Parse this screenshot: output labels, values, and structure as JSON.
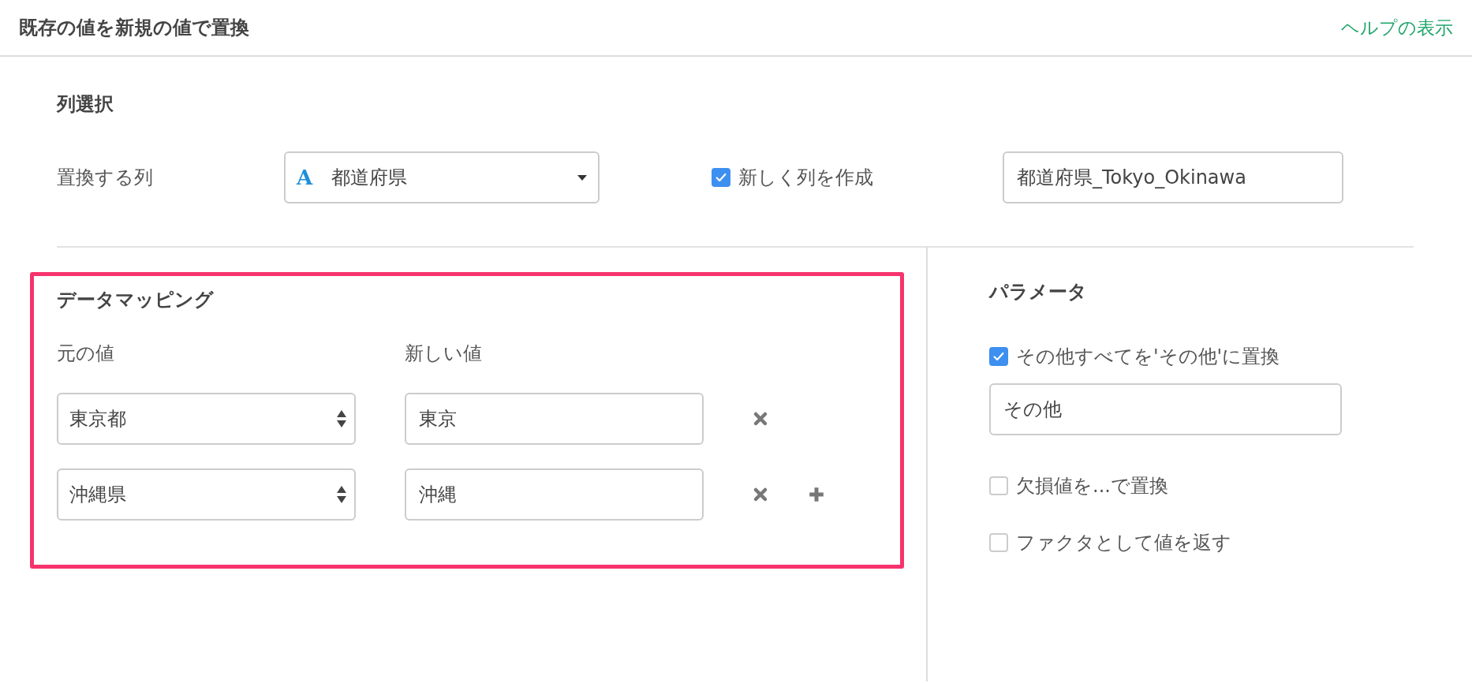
{
  "header": {
    "title": "既存の値を新規の値で置換",
    "help_link": "ヘルプの表示"
  },
  "column_selection": {
    "heading": "列選択",
    "label": "置換する列",
    "column_select": {
      "type_icon": "A",
      "value": "都道府県"
    },
    "create_new_column": {
      "label": "新しく列を作成",
      "checked": true
    },
    "new_column_name": {
      "value": "都道府県_Tokyo_Okinawa"
    }
  },
  "data_mapping": {
    "heading": "データマッピング",
    "columns": [
      "元の値",
      "新しい値"
    ],
    "rows": [
      {
        "original": "東京都",
        "new_value": "東京"
      },
      {
        "original": "沖縄県",
        "new_value": "沖縄"
      }
    ]
  },
  "parameters": {
    "heading": "パラメータ",
    "replace_others": {
      "label": "その他すべてを'その他'に置換",
      "checked": true
    },
    "others_value": {
      "value": "その他"
    },
    "options": [
      {
        "label": "欠損値を...で置換",
        "checked": false
      },
      {
        "label": "ファクタとして値を返す",
        "checked": false
      }
    ]
  }
}
